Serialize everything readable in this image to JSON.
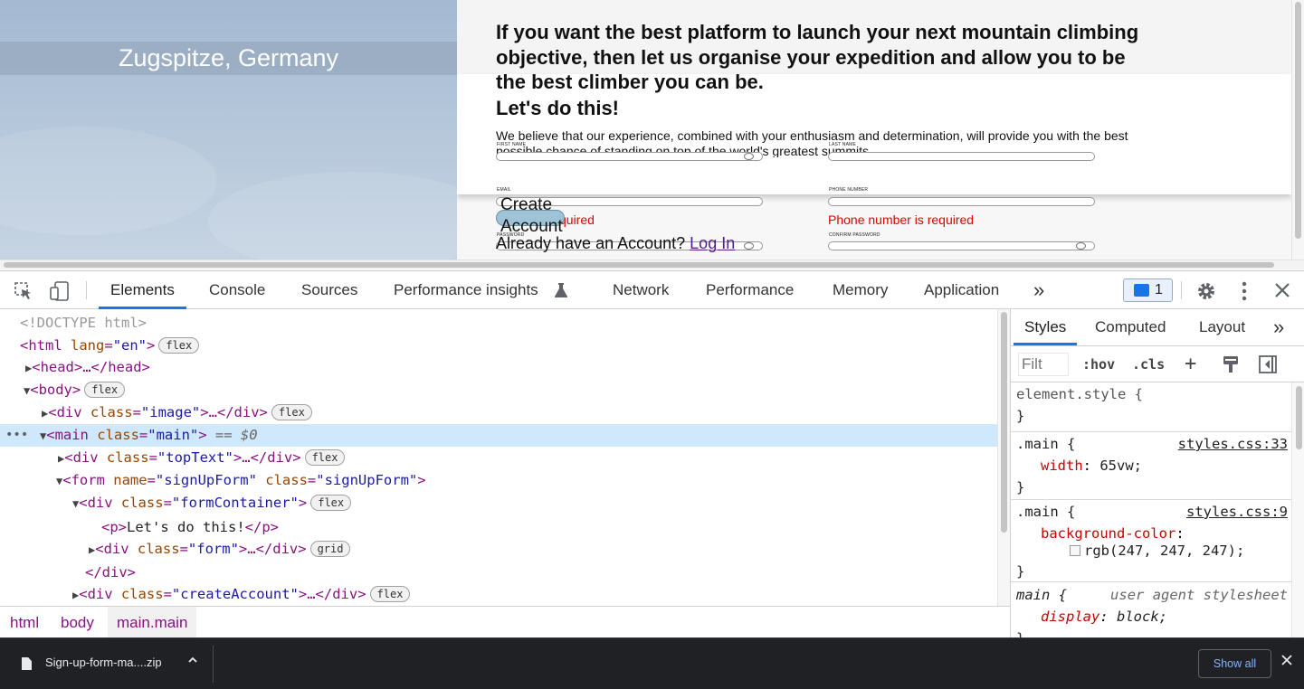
{
  "page": {
    "image_caption": "Zugspitze, Germany",
    "headline": "If you want the best platform to launch your next mountain climbing objective, then let us organise your expedition and allow you to be the best climber you can be.",
    "lets_do": "Let's do this!",
    "description": "We believe that our experience, combined with your enthusiasm and determination, will provide you with the best possible chance of standing on top of the world's greatest summits.",
    "labels": {
      "first_name": "FIRST NAME",
      "last_name": "LAST NAME",
      "email": "EMAIL",
      "phone": "PHONE NUMBER",
      "password": "PASSWORD",
      "confirm_password": "CONFIRM PASSWORD"
    },
    "errors": {
      "password_partial": "quired",
      "phone": "Phone number is required"
    },
    "create_account_label": "Create Account",
    "have_account_text": "Already have an Account?",
    "login_link": "Log In"
  },
  "devtools": {
    "tabs": [
      "Elements",
      "Console",
      "Sources",
      "Performance insights",
      "Network",
      "Performance",
      "Memory",
      "Application"
    ],
    "active_tab": "Elements",
    "more_tabs": "»",
    "issues_count": "1",
    "dom": {
      "doctype": "<!DOCTYPE html>",
      "html_open": "<html",
      "html_attr": " lang",
      "html_eq": "=",
      "html_val": "\"en\"",
      "html_close": ">",
      "head": "<head>…</head>",
      "body_open": "<body>",
      "div_open": "<div",
      "class_attr": " class",
      "eq": "=",
      "image_val": "\"image\"",
      "gt_ellipsis_div": ">…</div>",
      "main_open": "<main",
      "main_val": "\"main\"",
      "gt": ">",
      "dollar0": " == $0",
      "toptext_val": "\"topText\"",
      "form_open": "<form",
      "name_attr": " name",
      "signup_name_val": "\"signUpForm\"",
      "signup_class_val": "\"signUpForm\"",
      "formcontainer_val": "\"formContainer\"",
      "p_open": "<p>",
      "p_text": "Let's do this!",
      "p_close": "</p>",
      "form_val": "\"form\"",
      "div_close": "</div>",
      "createaccount_val": "\"createAccount\"",
      "pill_flex": "flex",
      "pill_grid": "grid",
      "ellipsis": "…"
    },
    "breadcrumbs": [
      "html",
      "body",
      "main.main"
    ],
    "styles": {
      "tabs": [
        "Styles",
        "Computed",
        "Layout"
      ],
      "more": "»",
      "filter_placeholder": "Filt",
      "hov": ":hov",
      "cls": ".cls",
      "plus": "+",
      "rules": [
        {
          "selector": "element.style {",
          "close": "}"
        },
        {
          "selector": ".main {",
          "source": "styles.css:33",
          "prop": "width",
          "value": "65vw;",
          "close": "}"
        },
        {
          "selector": ".main {",
          "source": "styles.css:9",
          "prop": "background-color",
          "value": "rgb(247, 247, 247);",
          "close": "}"
        },
        {
          "selector": "main {",
          "source": "user agent stylesheet",
          "prop": "display",
          "value": "block;",
          "close": "}"
        }
      ]
    }
  },
  "downloads": {
    "file_name": "Sign-up-form-ma....zip",
    "show_all": "Show all"
  },
  "colors": {
    "accent": "#1a73e8",
    "error": "#e00000",
    "main_bg": "#f7f7f7"
  }
}
